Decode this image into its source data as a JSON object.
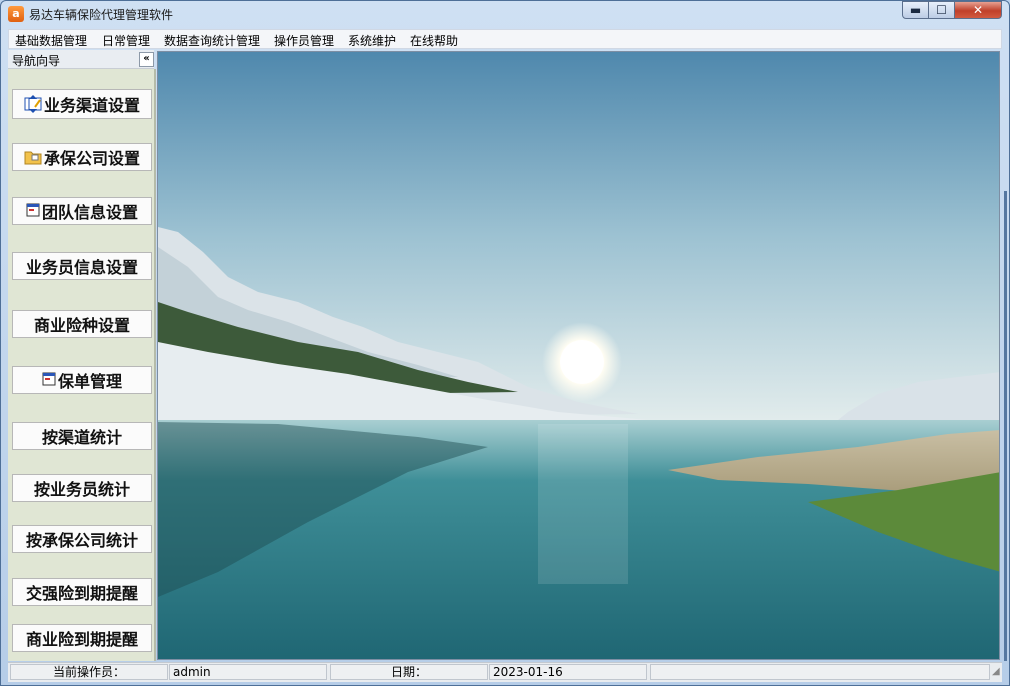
{
  "window": {
    "title": "易达车辆保险代理管理软件",
    "app_icon_glyph": "a",
    "controls": {
      "minimize": "▬",
      "maximize": "☐",
      "close": "✕"
    }
  },
  "menu": [
    {
      "label": "基础数据管理"
    },
    {
      "label": "日常管理"
    },
    {
      "label": "数据查询统计管理"
    },
    {
      "label": "操作员管理"
    },
    {
      "label": "系统维护"
    },
    {
      "label": "在线帮助"
    }
  ],
  "nav": {
    "title": "导航向导",
    "collapse": "«",
    "items": [
      {
        "label": "业务渠道设置",
        "icon": "channel-icon"
      },
      {
        "label": "承保公司设置",
        "icon": "folder-icon"
      },
      {
        "label": "团队信息设置",
        "icon": "window-icon"
      },
      {
        "label": "业务员信息设置",
        "icon": ""
      },
      {
        "label": "商业险种设置",
        "icon": ""
      },
      {
        "label": "保单管理",
        "icon": "window-icon"
      },
      {
        "label": "按渠道统计",
        "icon": ""
      },
      {
        "label": "按业务员统计",
        "icon": ""
      },
      {
        "label": "按承保公司统计",
        "icon": ""
      },
      {
        "label": "交强险到期提醒",
        "icon": ""
      },
      {
        "label": "商业险到期提醒",
        "icon": ""
      }
    ]
  },
  "status": {
    "operator_label": "当前操作员：",
    "operator_value": "admin",
    "date_label": "日期：",
    "date_value": "2023-01-16"
  },
  "colors": {
    "sky_top": "#5b91b3",
    "sky_horizon": "#d6e6ea",
    "water": "#2e7c86",
    "grass": "#5c8a3a"
  }
}
